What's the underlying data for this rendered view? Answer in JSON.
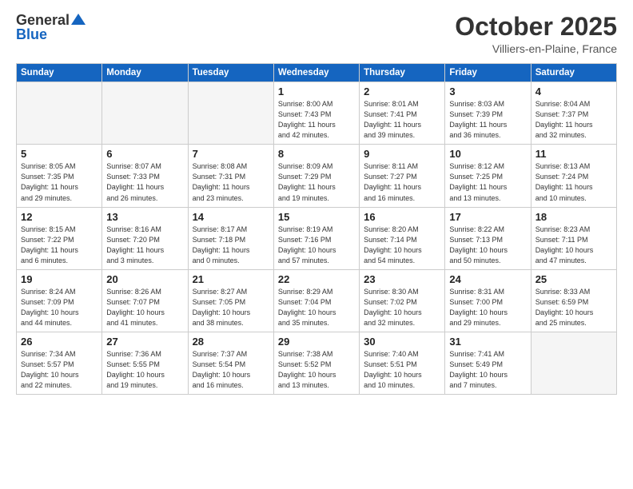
{
  "logo": {
    "general": "General",
    "blue": "Blue"
  },
  "header": {
    "month": "October 2025",
    "location": "Villiers-en-Plaine, France"
  },
  "weekdays": [
    "Sunday",
    "Monday",
    "Tuesday",
    "Wednesday",
    "Thursday",
    "Friday",
    "Saturday"
  ],
  "weeks": [
    [
      {
        "day": "",
        "info": ""
      },
      {
        "day": "",
        "info": ""
      },
      {
        "day": "",
        "info": ""
      },
      {
        "day": "1",
        "info": "Sunrise: 8:00 AM\nSunset: 7:43 PM\nDaylight: 11 hours\nand 42 minutes."
      },
      {
        "day": "2",
        "info": "Sunrise: 8:01 AM\nSunset: 7:41 PM\nDaylight: 11 hours\nand 39 minutes."
      },
      {
        "day": "3",
        "info": "Sunrise: 8:03 AM\nSunset: 7:39 PM\nDaylight: 11 hours\nand 36 minutes."
      },
      {
        "day": "4",
        "info": "Sunrise: 8:04 AM\nSunset: 7:37 PM\nDaylight: 11 hours\nand 32 minutes."
      }
    ],
    [
      {
        "day": "5",
        "info": "Sunrise: 8:05 AM\nSunset: 7:35 PM\nDaylight: 11 hours\nand 29 minutes."
      },
      {
        "day": "6",
        "info": "Sunrise: 8:07 AM\nSunset: 7:33 PM\nDaylight: 11 hours\nand 26 minutes."
      },
      {
        "day": "7",
        "info": "Sunrise: 8:08 AM\nSunset: 7:31 PM\nDaylight: 11 hours\nand 23 minutes."
      },
      {
        "day": "8",
        "info": "Sunrise: 8:09 AM\nSunset: 7:29 PM\nDaylight: 11 hours\nand 19 minutes."
      },
      {
        "day": "9",
        "info": "Sunrise: 8:11 AM\nSunset: 7:27 PM\nDaylight: 11 hours\nand 16 minutes."
      },
      {
        "day": "10",
        "info": "Sunrise: 8:12 AM\nSunset: 7:25 PM\nDaylight: 11 hours\nand 13 minutes."
      },
      {
        "day": "11",
        "info": "Sunrise: 8:13 AM\nSunset: 7:24 PM\nDaylight: 11 hours\nand 10 minutes."
      }
    ],
    [
      {
        "day": "12",
        "info": "Sunrise: 8:15 AM\nSunset: 7:22 PM\nDaylight: 11 hours\nand 6 minutes."
      },
      {
        "day": "13",
        "info": "Sunrise: 8:16 AM\nSunset: 7:20 PM\nDaylight: 11 hours\nand 3 minutes."
      },
      {
        "day": "14",
        "info": "Sunrise: 8:17 AM\nSunset: 7:18 PM\nDaylight: 11 hours\nand 0 minutes."
      },
      {
        "day": "15",
        "info": "Sunrise: 8:19 AM\nSunset: 7:16 PM\nDaylight: 10 hours\nand 57 minutes."
      },
      {
        "day": "16",
        "info": "Sunrise: 8:20 AM\nSunset: 7:14 PM\nDaylight: 10 hours\nand 54 minutes."
      },
      {
        "day": "17",
        "info": "Sunrise: 8:22 AM\nSunset: 7:13 PM\nDaylight: 10 hours\nand 50 minutes."
      },
      {
        "day": "18",
        "info": "Sunrise: 8:23 AM\nSunset: 7:11 PM\nDaylight: 10 hours\nand 47 minutes."
      }
    ],
    [
      {
        "day": "19",
        "info": "Sunrise: 8:24 AM\nSunset: 7:09 PM\nDaylight: 10 hours\nand 44 minutes."
      },
      {
        "day": "20",
        "info": "Sunrise: 8:26 AM\nSunset: 7:07 PM\nDaylight: 10 hours\nand 41 minutes."
      },
      {
        "day": "21",
        "info": "Sunrise: 8:27 AM\nSunset: 7:05 PM\nDaylight: 10 hours\nand 38 minutes."
      },
      {
        "day": "22",
        "info": "Sunrise: 8:29 AM\nSunset: 7:04 PM\nDaylight: 10 hours\nand 35 minutes."
      },
      {
        "day": "23",
        "info": "Sunrise: 8:30 AM\nSunset: 7:02 PM\nDaylight: 10 hours\nand 32 minutes."
      },
      {
        "day": "24",
        "info": "Sunrise: 8:31 AM\nSunset: 7:00 PM\nDaylight: 10 hours\nand 29 minutes."
      },
      {
        "day": "25",
        "info": "Sunrise: 8:33 AM\nSunset: 6:59 PM\nDaylight: 10 hours\nand 25 minutes."
      }
    ],
    [
      {
        "day": "26",
        "info": "Sunrise: 7:34 AM\nSunset: 5:57 PM\nDaylight: 10 hours\nand 22 minutes."
      },
      {
        "day": "27",
        "info": "Sunrise: 7:36 AM\nSunset: 5:55 PM\nDaylight: 10 hours\nand 19 minutes."
      },
      {
        "day": "28",
        "info": "Sunrise: 7:37 AM\nSunset: 5:54 PM\nDaylight: 10 hours\nand 16 minutes."
      },
      {
        "day": "29",
        "info": "Sunrise: 7:38 AM\nSunset: 5:52 PM\nDaylight: 10 hours\nand 13 minutes."
      },
      {
        "day": "30",
        "info": "Sunrise: 7:40 AM\nSunset: 5:51 PM\nDaylight: 10 hours\nand 10 minutes."
      },
      {
        "day": "31",
        "info": "Sunrise: 7:41 AM\nSunset: 5:49 PM\nDaylight: 10 hours\nand 7 minutes."
      },
      {
        "day": "",
        "info": ""
      }
    ]
  ]
}
